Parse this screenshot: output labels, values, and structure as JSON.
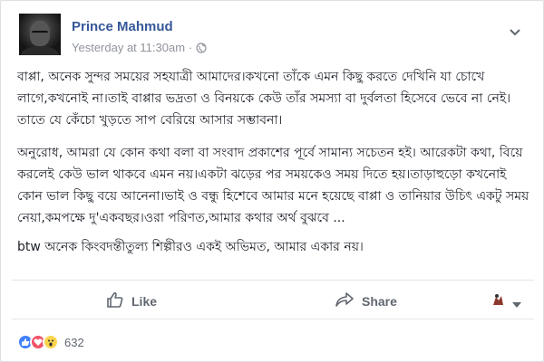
{
  "post": {
    "author": "Prince Mahmud",
    "timestamp": "Yesterday at 11:30am",
    "separator": "·",
    "privacy_icon": "globe-icon",
    "paragraphs": [
      "বাপ্পা, অনেক সুন্দর সময়ের সহযাত্রী আমাদের।কখনো তাঁকে এমন কিছু করতে দেখিনি যা চোখে লাগে,কখনোই না।তাই বাপ্পার ভদ্রতা ও বিনয়কে কেউ তাঁর সমস্যা বা দুর্বলতা হিসেবে ভেবে না নেই।তাতে যে কেঁচো খুড়তে সাপ বেরিয়ে আসার সম্ভাবনা।",
      "অনুরোধ, আমরা যে কোন কথা বলা বা সংবাদ প্রকাশের পূর্বে সামান্য সচেতন হই। আরেকটা কথা, বিয়ে করলেই কেউ ভাল থাকবে এমন নয়।একটা ঝড়ের পর সময়কেও সময় দিতে হয়।তাড়াহুড়ো কখনোই কোন ভাল কিছু বয়ে আনেনা।ভাই ও বন্ধু হিশেবে আমার মনে হয়েছে বাপ্পা ও তানিয়ার উচিৎ একটু সময় নেয়া,কমপক্ষে দু'একবছর।ওরা পরিণত,আমার কথার অর্থ বুঝবে ...",
      "btw অনেক কিংবদন্তীতুল্য শিল্পীরও একই অভিমত, আমার একার নয়।"
    ]
  },
  "actions": {
    "like_label": "Like",
    "share_label": "Share"
  },
  "reactions": {
    "types": [
      "like",
      "love",
      "wow"
    ],
    "count": "632"
  },
  "colors": {
    "author_link": "#365899",
    "meta_text": "#90949c",
    "action_text": "#606770"
  }
}
